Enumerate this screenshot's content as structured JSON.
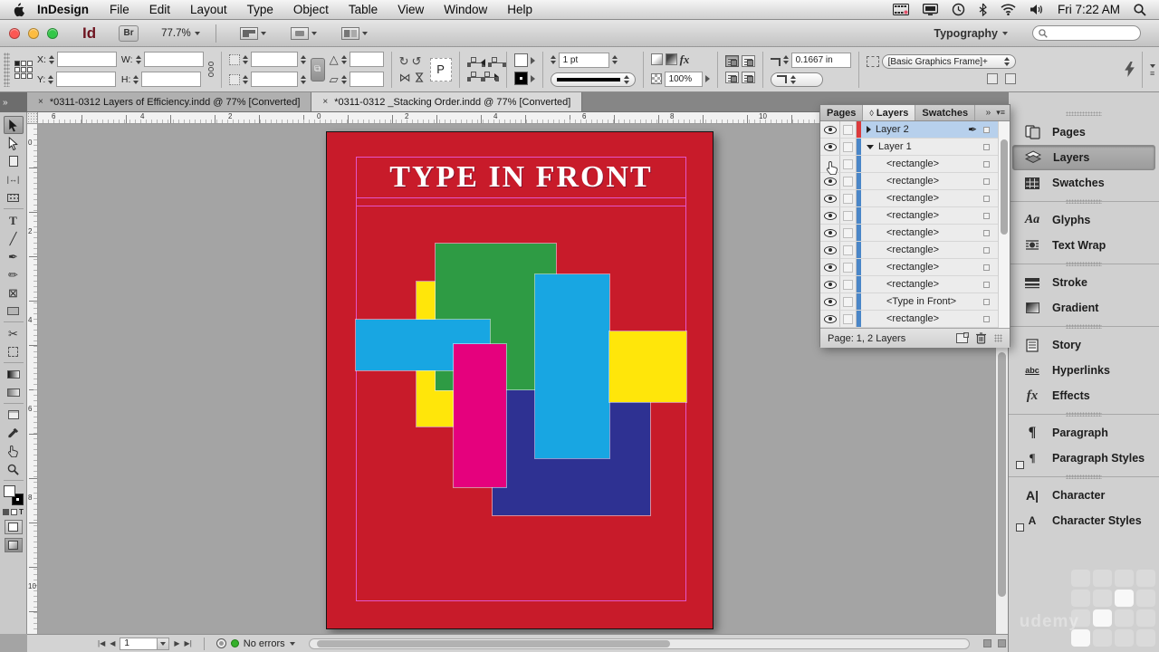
{
  "menubar": {
    "app_name": "InDesign",
    "menus": [
      "File",
      "Edit",
      "Layout",
      "Type",
      "Object",
      "Table",
      "View",
      "Window",
      "Help"
    ],
    "clock": "Fri 7:22 AM"
  },
  "titlebar": {
    "id_logo": "Id",
    "bridge": "Br",
    "zoom": "77.7%",
    "workspace": "Typography"
  },
  "control_panel": {
    "x": "X:",
    "y": "Y:",
    "w": "W:",
    "h": "H:",
    "proxy": "P",
    "rotate_cw": "↻",
    "rotate_ccw": "↺",
    "flip": "⋈",
    "rotate_angle_icon": "△",
    "shear_icon": "▱",
    "stroke_weight": "1 pt",
    "opacity": "100%",
    "fx": "fx",
    "corner_radius": "0.1667 in",
    "object_style": "[Basic Graphics Frame]+"
  },
  "tabs": [
    {
      "close": "×",
      "title": "*0311-0312 Layers of Efficiency.indd @ 77% [Converted]"
    },
    {
      "close": "×",
      "title": "*0311-0312 _Stacking Order.indd @ 77% [Converted]"
    }
  ],
  "rulers": {
    "h": [
      "6",
      "4",
      "2",
      "0",
      "2",
      "4",
      "6",
      "8",
      "10"
    ],
    "v": [
      "0",
      "2",
      "4",
      "6",
      "8",
      "10"
    ]
  },
  "document": {
    "title": "TYPE IN FRONT",
    "page_color": "#C81B2A",
    "colors": {
      "green": "#2E9B44",
      "cyan": "#18A6E2",
      "yellow": "#FFE60A",
      "magenta": "#E5017D",
      "dark_blue": "#2E3192"
    }
  },
  "tools": {
    "type": "T",
    "line": "╱",
    "pen": "✒",
    "pencil": "✏",
    "frame": "⊠",
    "scissors": "✂",
    "gap": "↔",
    "collapse": "»"
  },
  "layers_panel": {
    "tabs": [
      "Pages",
      "Layers",
      "Swatches"
    ],
    "diamond": "◊",
    "chevrons": "»",
    "menu_icon": "▾≡",
    "layer_colors": {
      "layer2": "#DC3A3C",
      "layer1": "#4A86C8"
    },
    "pen_icon": "✒",
    "rows": [
      {
        "label": "Layer 2"
      },
      {
        "label": "Layer 1"
      },
      {
        "label": "<rectangle>"
      },
      {
        "label": "<rectangle>"
      },
      {
        "label": "<rectangle>"
      },
      {
        "label": "<rectangle>"
      },
      {
        "label": "<rectangle>"
      },
      {
        "label": "<rectangle>"
      },
      {
        "label": "<rectangle>"
      },
      {
        "label": "<rectangle>"
      },
      {
        "label": "<Type in Front>"
      },
      {
        "label": "<rectangle>"
      }
    ],
    "status": "Page: 1, 2 Layers"
  },
  "dock": {
    "items": [
      {
        "label": "Pages"
      },
      {
        "label": "Layers"
      },
      {
        "label": "Swatches"
      },
      {
        "label": "Glyphs"
      },
      {
        "label": "Text Wrap"
      },
      {
        "label": "Stroke"
      },
      {
        "label": "Gradient"
      },
      {
        "label": "Story"
      },
      {
        "label": "Hyperlinks"
      },
      {
        "label": "Effects"
      },
      {
        "label": "Paragraph"
      },
      {
        "label": "Paragraph Styles"
      },
      {
        "label": "Character"
      },
      {
        "label": "Character Styles"
      }
    ],
    "icon_glyphs": {
      "glyphs": "Aa",
      "effects": "fx",
      "paragraph": "¶",
      "character": "A",
      "hyperlinks": "abc"
    }
  },
  "statusbar": {
    "page": "1",
    "errors": "No errors",
    "status_green": "#35B02B"
  },
  "traffic_lights": {
    "red": "#FC5753",
    "yellow": "#FDBC40",
    "green": "#33C748"
  },
  "watermark": "udemy"
}
